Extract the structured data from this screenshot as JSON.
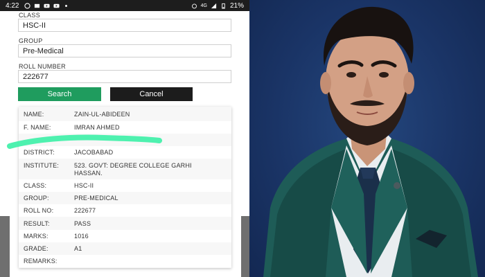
{
  "status_bar": {
    "time": "4:22",
    "network": "4G",
    "battery": "21%"
  },
  "form": {
    "class_label": "CLASS",
    "class_value": "HSC-II",
    "group_label": "GROUP",
    "group_value": "Pre-Medical",
    "roll_label": "ROLL NUMBER",
    "roll_value": "222677",
    "search_button": "Search",
    "cancel_button": "Cancel"
  },
  "result": {
    "rows": [
      {
        "key": "NAME:",
        "value": "ZAIN-UL-ABIDEEN"
      },
      {
        "key": "F. NAME:",
        "value": "IMRAN AHMED"
      },
      {
        "key": "",
        "value": ""
      },
      {
        "key": "DISTRICT:",
        "value": "JACOBABAD"
      },
      {
        "key": "INSTITUTE:",
        "value": "523. GOVT: DEGREE COLLEGE GARHI HASSAN."
      },
      {
        "key": "CLASS:",
        "value": "HSC-II"
      },
      {
        "key": "GROUP:",
        "value": "PRE-MEDICAL"
      },
      {
        "key": "ROLL NO:",
        "value": "222677"
      },
      {
        "key": "RESULT:",
        "value": "PASS"
      },
      {
        "key": "MARKS:",
        "value": "1016"
      },
      {
        "key": "GRADE:",
        "value": "A1"
      },
      {
        "key": "REMARKS:",
        "value": ""
      }
    ]
  },
  "colors": {
    "search_button": "#1f9c5e",
    "cancel_button": "#1c1c1c",
    "highlight_stroke": "#3ff0a8",
    "photo_background": "#1a3466"
  }
}
